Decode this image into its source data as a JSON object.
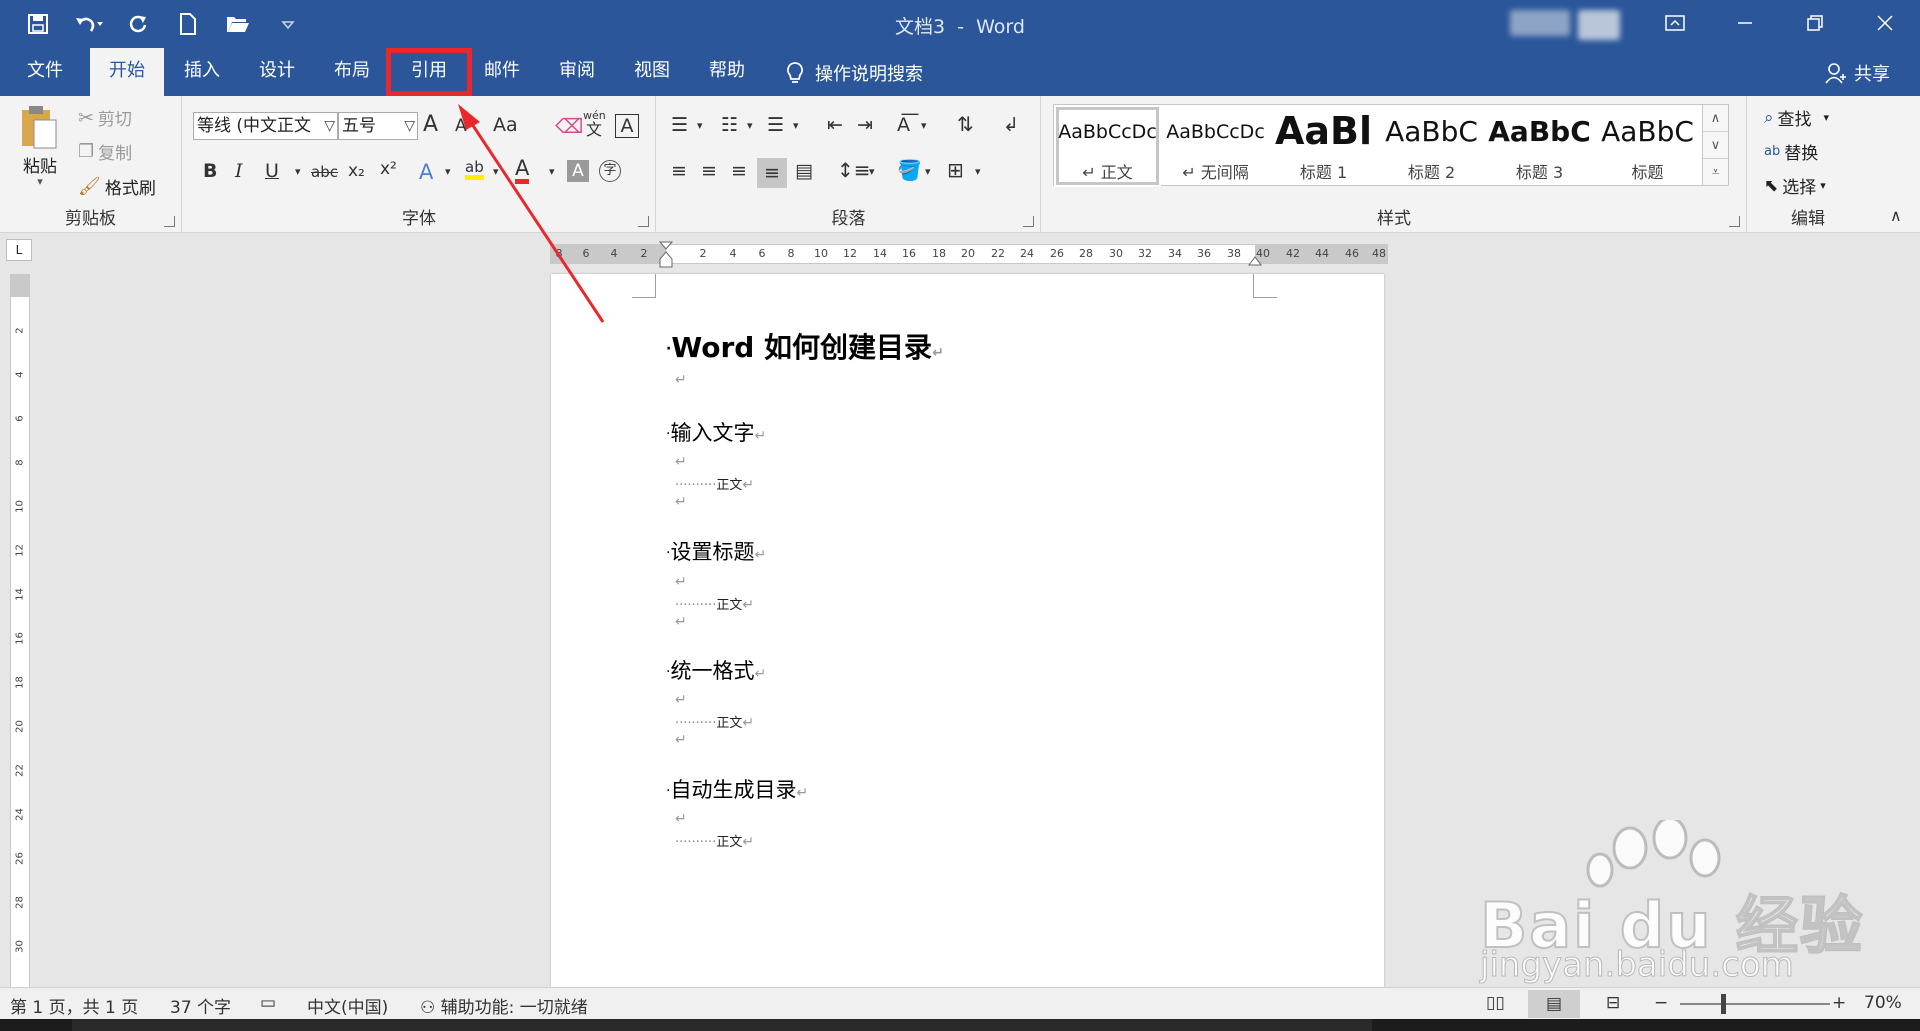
{
  "window": {
    "doc_name": "文档3",
    "separator": "-",
    "app_name": "Word"
  },
  "tabs": [
    {
      "label": "文件"
    },
    {
      "label": "开始"
    },
    {
      "label": "插入"
    },
    {
      "label": "设计"
    },
    {
      "label": "布局"
    },
    {
      "label": "引用"
    },
    {
      "label": "邮件"
    },
    {
      "label": "审阅"
    },
    {
      "label": "视图"
    },
    {
      "label": "帮助"
    }
  ],
  "tellme": "操作说明搜索",
  "share": "共享",
  "clipboard": {
    "paste": "粘贴",
    "cut": "剪切",
    "copy": "复制",
    "format_painter": "格式刷",
    "label": "剪贴板"
  },
  "font": {
    "family": "等线 (中文正文",
    "size": "五号",
    "grow": "A",
    "shrink": "A",
    "case": "Aa",
    "bold": "B",
    "italic": "I",
    "underline": "U",
    "strike": "abc",
    "sub": "x₂",
    "sup": "x²",
    "phonetic_top": "wén",
    "phonetic_bottom": "文",
    "label": "字体"
  },
  "paragraph": {
    "label": "段落"
  },
  "styles": {
    "label": "样式",
    "items": [
      {
        "preview": "AaBbCcDc",
        "name": "正文"
      },
      {
        "preview": "AaBbCcDc",
        "name": "无间隔"
      },
      {
        "preview": "AaBl",
        "name": "标题 1"
      },
      {
        "preview": "AaBbC",
        "name": "标题 2"
      },
      {
        "preview": "AaBbC",
        "name": "标题 3"
      },
      {
        "preview": "AaBbC",
        "name": "标题"
      }
    ]
  },
  "editing": {
    "find": "查找",
    "replace": "替换",
    "select": "选择",
    "label": "编辑"
  },
  "ruler": {
    "corner": "L",
    "h_ticks": [
      "8",
      "6",
      "4",
      "2",
      "",
      "2",
      "4",
      "6",
      "8",
      "10",
      "12",
      "14",
      "16",
      "18",
      "20",
      "22",
      "24",
      "26",
      "28",
      "30",
      "32",
      "34",
      "36",
      "38",
      "40",
      "42",
      "44",
      "46",
      "48"
    ],
    "v_ticks": [
      "2",
      "4",
      "6",
      "8",
      "10",
      "12",
      "14",
      "16",
      "18",
      "20",
      "22",
      "24",
      "26",
      "28",
      "30"
    ]
  },
  "document": {
    "title": "Word 如何创建目录",
    "return_mark": "↵",
    "sections": [
      {
        "heading": "输入文字",
        "body": "正文"
      },
      {
        "heading": "设置标题",
        "body": "正文"
      },
      {
        "heading": "统一格式",
        "body": "正文"
      },
      {
        "heading": "自动生成目录",
        "body": "正文"
      }
    ]
  },
  "status": {
    "page": "第 1 页，共 1 页",
    "words": "37 个字",
    "language": "中文(中国)",
    "accessibility": "辅助功能: 一切就绪",
    "zoom": "70%",
    "zoom_minus": "−",
    "zoom_plus": "+"
  },
  "watermark": {
    "brand": "Bai du 经验",
    "url": "jingyan.baidu.com"
  },
  "colors": {
    "brand_blue": "#2b579a",
    "highlight_red": "#e8282b",
    "ribbon_bg": "#f3f3f3"
  }
}
